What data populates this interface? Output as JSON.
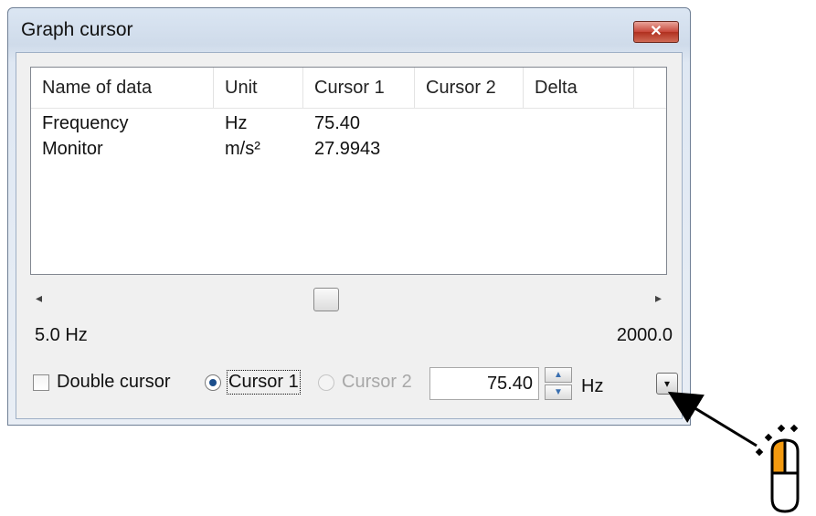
{
  "window": {
    "title": "Graph cursor",
    "close_label": "✕"
  },
  "table": {
    "columns": [
      "Name of data",
      "Unit",
      "Cursor 1",
      "Cursor 2",
      "Delta"
    ],
    "rows": [
      {
        "name": "Frequency",
        "unit": "Hz",
        "cursor1": "75.40",
        "cursor2": "",
        "delta": ""
      },
      {
        "name": "Monitor",
        "unit": "m/s²",
        "cursor1": "27.9943",
        "cursor2": "",
        "delta": ""
      }
    ]
  },
  "range": {
    "min_label": "5.0  Hz",
    "max_label": "2000.0"
  },
  "controls": {
    "double_cursor_label": "Double cursor",
    "cursor1_label": "Cursor 1",
    "cursor2_label": "Cursor 2",
    "value": "75.40",
    "unit": "Hz"
  },
  "icons": {
    "arrow_left": "◂",
    "arrow_right": "▸",
    "spin_up": "▲",
    "spin_down": "▼",
    "dropdown": "▾"
  },
  "colors": {
    "close_button": "#c8473a",
    "mouse_button": "#f39a10"
  }
}
